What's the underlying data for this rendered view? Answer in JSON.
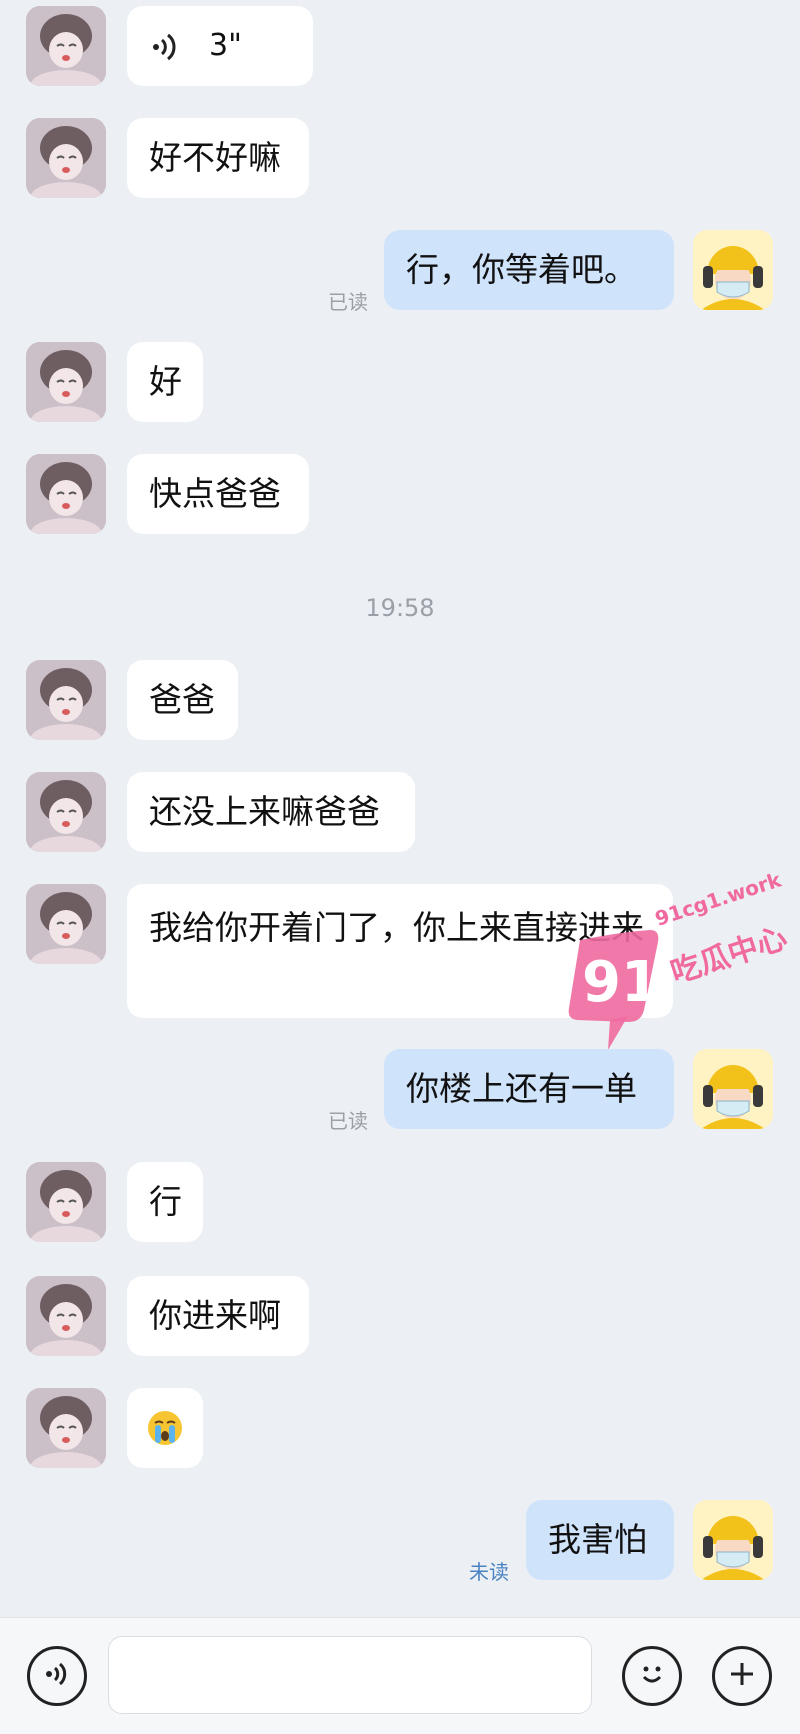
{
  "messages": [
    {
      "side": "in",
      "type": "voice",
      "duration": "3\""
    },
    {
      "side": "in",
      "text": "好不好嘛"
    },
    {
      "side": "out",
      "text": "行，你等着吧。",
      "status": "已读"
    },
    {
      "side": "in",
      "text": "好"
    },
    {
      "side": "in",
      "text": "快点爸爸"
    },
    {
      "side": "in",
      "text": "爸爸"
    },
    {
      "side": "in",
      "text": "还没上来嘛爸爸"
    },
    {
      "side": "in",
      "text": "我给你开着门了，你上来直接进来"
    },
    {
      "side": "out",
      "text": "你楼上还有一单",
      "status": "已读"
    },
    {
      "side": "in",
      "text": "行"
    },
    {
      "side": "in",
      "text": "你进来啊"
    },
    {
      "side": "in",
      "type": "emoji",
      "emoji": "crying-face"
    },
    {
      "side": "out",
      "text": "我害怕",
      "status": "未读"
    }
  ],
  "timestamp": "19:58",
  "watermark": {
    "number": "91",
    "site": "91cg1.work",
    "name": "吃瓜中心",
    "color": "#f06aa0"
  },
  "input_bar": {
    "voice_icon": "voice-icon",
    "emoji_icon": "emoji-icon",
    "plus_icon": "plus-icon",
    "input_value": ""
  },
  "colors": {
    "background": "#eceff4",
    "incoming_bubble": "#ffffff",
    "outgoing_bubble": "#cfe3fb",
    "read": "#9aa0a8",
    "unread": "#4a83c2"
  }
}
